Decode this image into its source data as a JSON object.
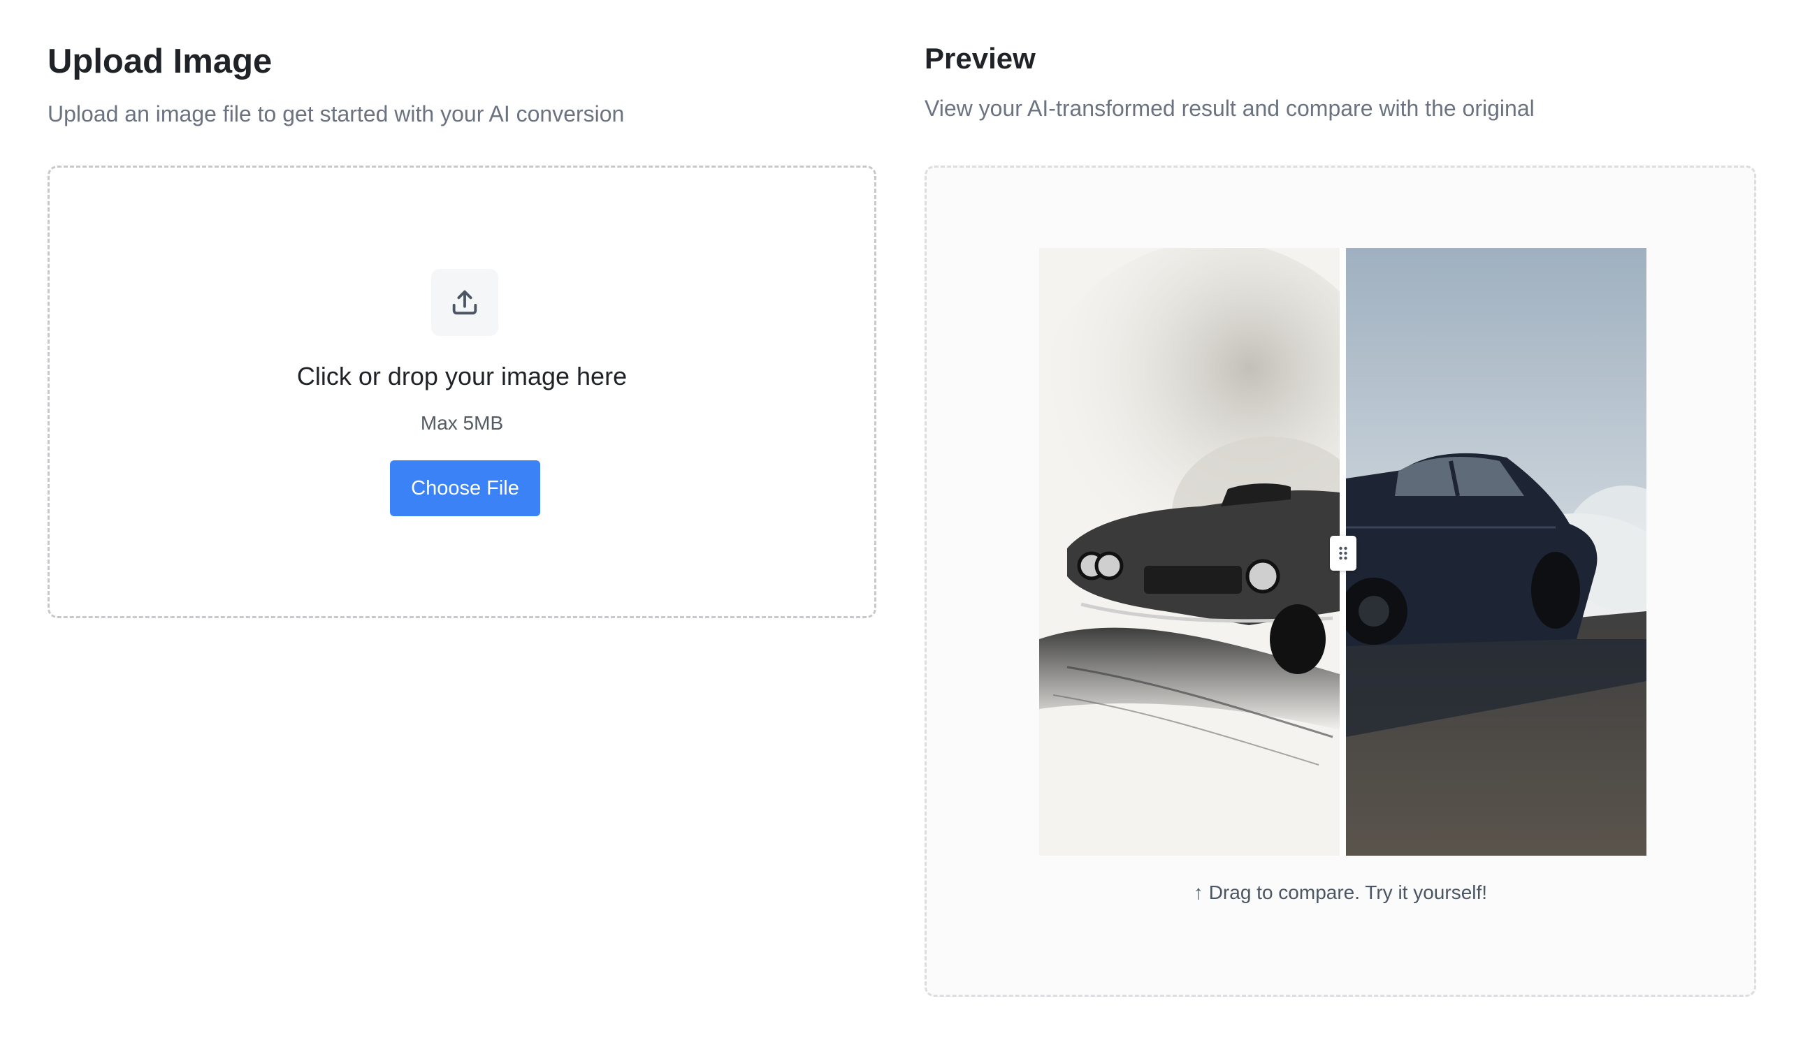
{
  "upload": {
    "title": "Upload Image",
    "subtitle": "Upload an image file to get started with your AI conversion",
    "drop_title": "Click or drop your image here",
    "drop_hint": "Max 5MB",
    "choose_button": "Choose File",
    "icon": "upload-icon"
  },
  "preview": {
    "title": "Preview",
    "subtitle": "View your AI-transformed result and compare with the original",
    "compare_hint": "↑ Drag to compare. Try it yourself!",
    "left_image": "pencil-sketch-muscle-car",
    "right_image": "photo-realistic-muscle-car-drifting",
    "handle_icon": "drag-handle-icon"
  },
  "colors": {
    "accent": "#3b82f6",
    "subtitle": "#6b7280"
  }
}
